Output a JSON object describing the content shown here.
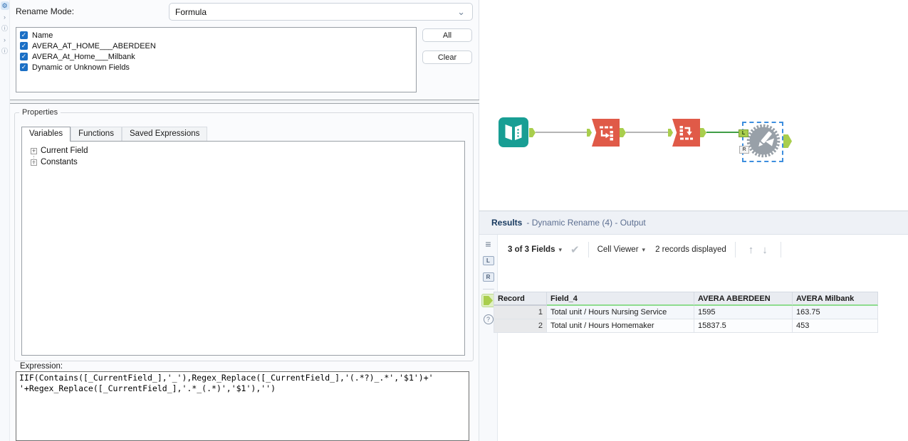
{
  "icons": {
    "gear": "⚙",
    "chevron_right": "›",
    "circle_info": "ⓘ",
    "chevron_down": "⌄",
    "caret_down": "▾",
    "check_small": "✓",
    "check_big": "✔",
    "arrow_up": "↑",
    "arrow_down": "↓",
    "list": "≡",
    "plus": "+",
    "help": "?"
  },
  "colors": {
    "checkbox_blue": "#1b6fc5",
    "tool_teal": "#189e94",
    "tool_orange": "#e05a48",
    "anchor_green": "#a9ce4d",
    "connection_green": "#3f9e46",
    "selection_blue": "#3d8ede",
    "gear_gray": "#98a0a8",
    "header_underline_green": "#8edc8e"
  },
  "config_panel": {
    "rename_mode_label": "Rename Mode:",
    "rename_mode_value": "Formula",
    "all_button": "All",
    "clear_button": "Clear",
    "fields": [
      {
        "label": "Name",
        "checked": true
      },
      {
        "label": "AVERA_AT_HOME___ABERDEEN",
        "checked": true
      },
      {
        "label": "AVERA_At_Home___Milbank",
        "checked": true
      },
      {
        "label": "Dynamic or Unknown Fields",
        "checked": true
      }
    ],
    "properties": {
      "legend": "Properties",
      "tabs": [
        {
          "label": "Variables",
          "active": true
        },
        {
          "label": "Functions",
          "active": false
        },
        {
          "label": "Saved Expressions",
          "active": false
        }
      ],
      "tree": [
        {
          "label": "Current Field"
        },
        {
          "label": "Constants"
        }
      ]
    },
    "expression_label": "Expression:",
    "expression_value": "IIF(Contains([_CurrentField_],'_'),Regex_Replace([_CurrentField_],'(.*?)_.*','$1')+'\n'+Regex_Replace([_CurrentField_],'.*_(.*)','$1'),'')"
  },
  "canvas": {
    "dynamic_rename_anchor_left": "L",
    "dynamic_rename_anchor_right": "R"
  },
  "results": {
    "title": "Results",
    "subtitle": "- Dynamic Rename (4) - Output",
    "toolbar": {
      "fields_summary": "3 of 3 Fields",
      "cell_viewer_label": "Cell Viewer",
      "records_displayed": "2 records displayed"
    },
    "sidebar": {
      "input_left": "L",
      "input_right": "R"
    },
    "table": {
      "columns": [
        "Record",
        "Field_4",
        "AVERA ABERDEEN",
        "AVERA Milbank"
      ],
      "rows": [
        [
          "1",
          "Total unit / Hours Nursing Service",
          "1595",
          "163.75"
        ],
        [
          "2",
          "Total unit / Hours Homemaker",
          "15837.5",
          "453"
        ]
      ]
    }
  }
}
